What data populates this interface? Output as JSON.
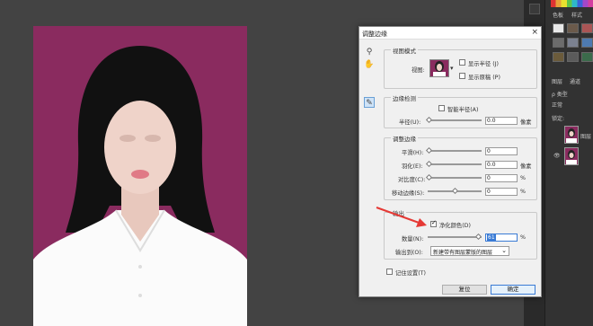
{
  "dialog": {
    "title": "调整边缘",
    "close_glyph": "×",
    "view_mode": {
      "group_title": "视图模式",
      "view_label": "视图:",
      "show_radius": "显示半径 (J)",
      "show_original": "显示原稿 (P)"
    },
    "edge_detection": {
      "group_title": "边缘检测",
      "smart_radius": "智能半径(A)",
      "radius_label": "半径(U):",
      "radius_value": "0.0",
      "radius_unit": "像素"
    },
    "adjust_edge": {
      "group_title": "调整边缘",
      "smooth_label": "平滑(H):",
      "smooth_value": "0",
      "feather_label": "羽化(E):",
      "feather_value": "0.0",
      "feather_unit": "像素",
      "contrast_label": "对比度(C):",
      "contrast_value": "0",
      "contrast_unit": "%",
      "shift_label": "移动边缘(S):",
      "shift_value": "0",
      "shift_unit": "%"
    },
    "output": {
      "group_title": "输出",
      "decontaminate_label": "净化颜色(D)",
      "decontaminate_checked": true,
      "amount_label": "数量(N):",
      "amount_value": "61",
      "amount_unit": "%",
      "output_to_label": "输出到(O):",
      "output_to_value": "新建带有图层蒙版的图层"
    },
    "remember_label": "记住设置(T)",
    "reset_button": "复位",
    "ok_button": "确定"
  },
  "panels": {
    "tab_swatches": "色板",
    "tab_styles": "样式",
    "tab_layers": "图层",
    "tab_channels": "通道",
    "kind_label": "ρ 类型",
    "mode_label": "正常",
    "lock_label": "锁定:",
    "layer_name": "图层"
  },
  "colors": {
    "photo_bg": "#8a2b5f",
    "accent": "#3a7bd5",
    "arrow": "#e53935"
  }
}
